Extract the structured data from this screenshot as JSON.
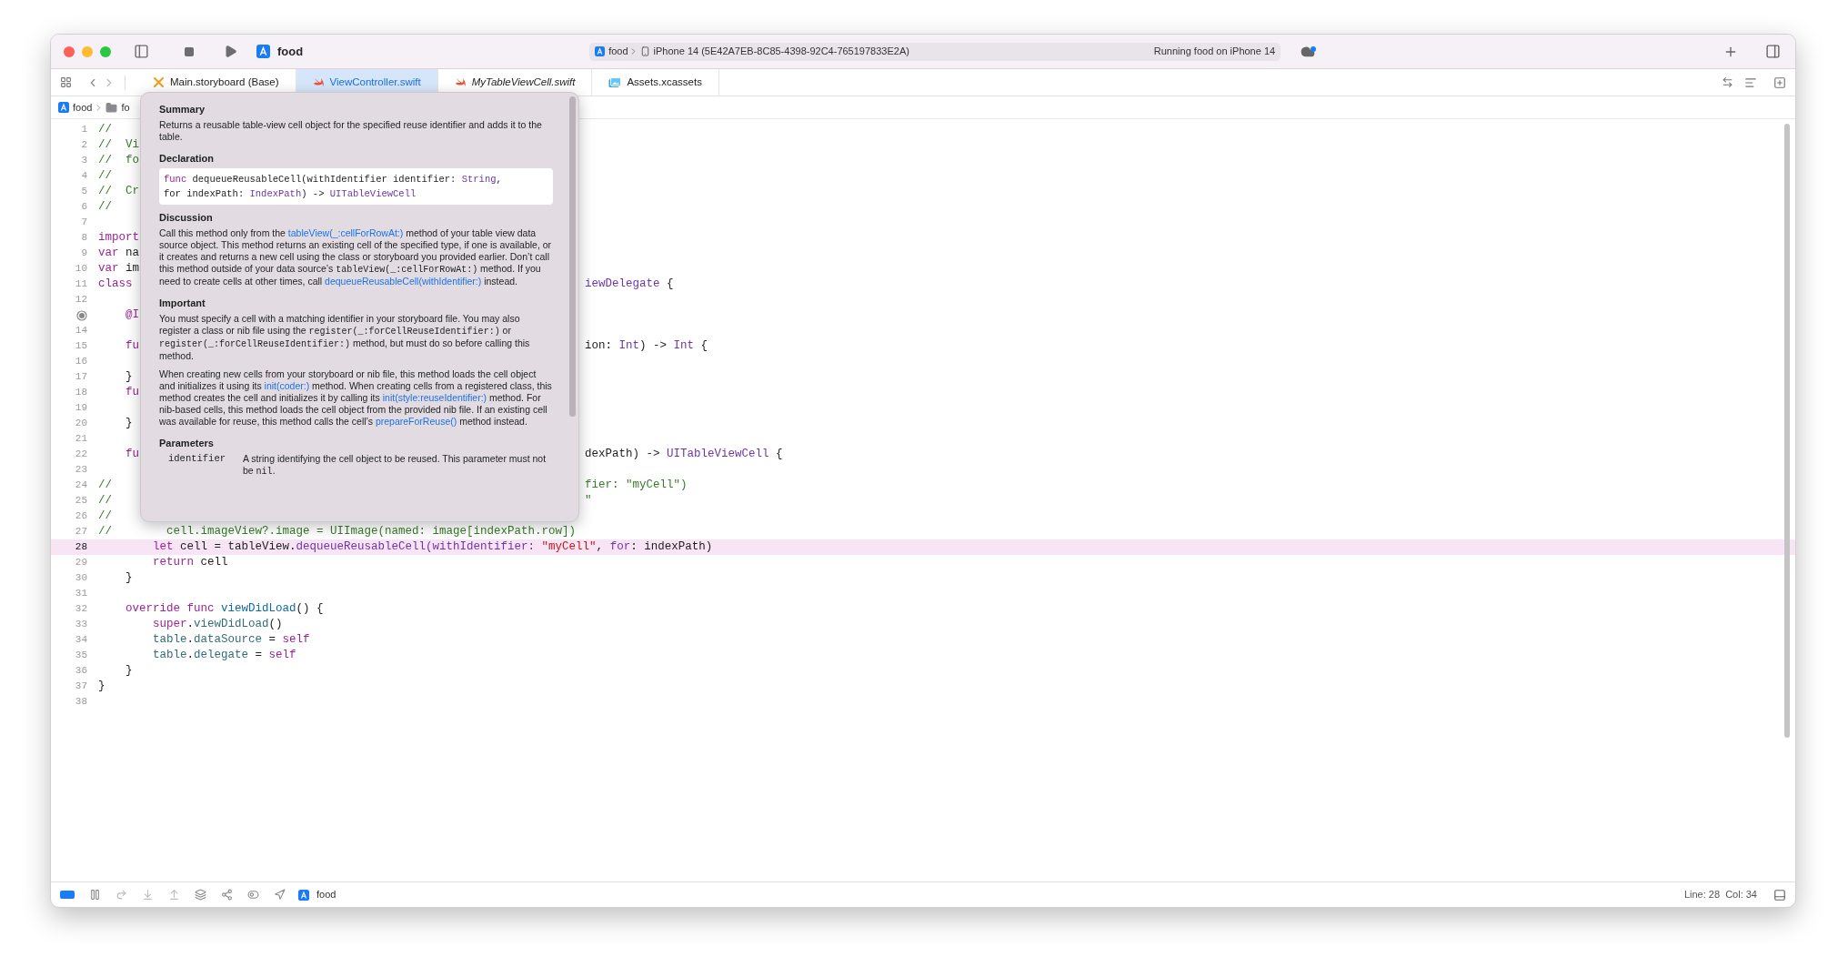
{
  "window": {
    "app_name": "food"
  },
  "toolbar": {
    "scheme": "food",
    "device": "iPhone 14 (5E42A7EB-8C85-4398-92C4-765197833E2A)",
    "status": "Running food on iPhone 14"
  },
  "tabs": [
    {
      "label": "Main.storyboard (Base)",
      "kind": "storyboard",
      "selected": false,
      "italic": false
    },
    {
      "label": "ViewController.swift",
      "kind": "swift",
      "selected": true,
      "italic": false
    },
    {
      "label": "MyTableViewCell.swift",
      "kind": "swift",
      "selected": false,
      "italic": true
    },
    {
      "label": "Assets.xcassets",
      "kind": "assets",
      "selected": false,
      "italic": false
    }
  ],
  "breadcrumb": [
    {
      "label": "food",
      "kind": "project"
    },
    {
      "label": "fo",
      "kind": "folder"
    }
  ],
  "editor": {
    "lines": [
      {
        "number": "1",
        "highlighted": false,
        "outlet_connected": false,
        "left": [
          {
            "text": "//",
            "kind": "comment"
          }
        ]
      },
      {
        "number": "2",
        "highlighted": false,
        "outlet_connected": false,
        "left": [
          {
            "text": "//  Vi",
            "kind": "comment"
          }
        ]
      },
      {
        "number": "3",
        "highlighted": false,
        "outlet_connected": false,
        "left": [
          {
            "text": "//  fo",
            "kind": "comment"
          }
        ]
      },
      {
        "number": "4",
        "highlighted": false,
        "outlet_connected": false,
        "left": [
          {
            "text": "//",
            "kind": "comment"
          }
        ]
      },
      {
        "number": "5",
        "highlighted": false,
        "outlet_connected": false,
        "left": [
          {
            "text": "//  Cr",
            "kind": "comment"
          }
        ]
      },
      {
        "number": "6",
        "highlighted": false,
        "outlet_connected": false,
        "left": [
          {
            "text": "//",
            "kind": "comment"
          }
        ]
      },
      {
        "number": "7",
        "highlighted": false,
        "outlet_connected": false
      },
      {
        "number": "8",
        "highlighted": false,
        "outlet_connected": false,
        "left": [
          {
            "text": "import",
            "kind": "kw"
          }
        ]
      },
      {
        "number": "9",
        "highlighted": false,
        "outlet_connected": false,
        "left": [
          {
            "text": "var",
            "kind": "kw"
          },
          {
            "text": " na",
            "kind": "plain"
          }
        ]
      },
      {
        "number": "10",
        "highlighted": false,
        "outlet_connected": false,
        "left": [
          {
            "text": "var",
            "kind": "kw"
          },
          {
            "text": " im",
            "kind": "plain"
          }
        ]
      },
      {
        "number": "11",
        "highlighted": false,
        "outlet_connected": false,
        "left": [
          {
            "text": "class",
            "kind": "kw"
          }
        ],
        "right": [
          {
            "text": "iewDelegate",
            "kind": "type"
          },
          {
            "text": " {",
            "kind": "plain"
          }
        ]
      },
      {
        "number": "12",
        "highlighted": false,
        "outlet_connected": false
      },
      {
        "highlighted": false,
        "outlet_connected": true,
        "left": [
          {
            "text": "    @I",
            "kind": "kw"
          }
        ]
      },
      {
        "number": "14",
        "highlighted": false,
        "outlet_connected": false
      },
      {
        "number": "15",
        "highlighted": false,
        "outlet_connected": false,
        "left": [
          {
            "text": "    fu",
            "kind": "kw"
          }
        ],
        "right": [
          {
            "text": "ion: ",
            "kind": "plain"
          },
          {
            "text": "Int",
            "kind": "type"
          },
          {
            "text": ") -> ",
            "kind": "plain"
          },
          {
            "text": "Int",
            "kind": "type"
          },
          {
            "text": " {",
            "kind": "plain"
          }
        ]
      },
      {
        "number": "16",
        "highlighted": false,
        "outlet_connected": false
      },
      {
        "number": "17",
        "highlighted": false,
        "outlet_connected": false,
        "left": [
          {
            "text": "    }",
            "kind": "plain"
          }
        ]
      },
      {
        "number": "18",
        "highlighted": false,
        "outlet_connected": false,
        "left": [
          {
            "text": "    fu",
            "kind": "kw"
          }
        ]
      },
      {
        "number": "19",
        "highlighted": false,
        "outlet_connected": false
      },
      {
        "number": "20",
        "highlighted": false,
        "outlet_connected": false,
        "left": [
          {
            "text": "    }",
            "kind": "plain"
          }
        ]
      },
      {
        "number": "21",
        "highlighted": false,
        "outlet_connected": false
      },
      {
        "number": "22",
        "highlighted": false,
        "outlet_connected": false,
        "left": [
          {
            "text": "    fu",
            "kind": "kw"
          }
        ],
        "right": [
          {
            "text": "dexPath) -> ",
            "kind": "plain"
          },
          {
            "text": "UITableViewCell",
            "kind": "type"
          },
          {
            "text": " {",
            "kind": "plain"
          }
        ]
      },
      {
        "number": "23",
        "highlighted": false,
        "outlet_connected": false
      },
      {
        "number": "24",
        "highlighted": false,
        "outlet_connected": false,
        "left": [
          {
            "text": "//",
            "kind": "comment"
          }
        ],
        "right": [
          {
            "text": "fier: \"myCell\")",
            "kind": "comment"
          }
        ]
      },
      {
        "number": "25",
        "highlighted": false,
        "outlet_connected": false,
        "left": [
          {
            "text": "//",
            "kind": "comment"
          }
        ],
        "right": [
          {
            "text": "\"",
            "kind": "comment"
          }
        ]
      },
      {
        "number": "26",
        "highlighted": false,
        "outlet_connected": false,
        "left": [
          {
            "text": "//",
            "kind": "comment"
          }
        ]
      },
      {
        "number": "27",
        "highlighted": false,
        "outlet_connected": false,
        "left": [
          {
            "text": "//        cell.imageView?.image = UIImage(named: image[indexPath.row])",
            "kind": "comment"
          }
        ]
      },
      {
        "number": "28",
        "highlighted": true,
        "outlet_connected": false,
        "left": [
          {
            "text": "        let",
            "kind": "kw"
          },
          {
            "text": " cell = tableView.",
            "kind": "plain"
          },
          {
            "text": "dequeueReusableCell(withIdentifier:",
            "kind": "call"
          },
          {
            "text": " \"myCell\"",
            "kind": "str"
          },
          {
            "text": ", ",
            "kind": "plain"
          },
          {
            "text": "for",
            "kind": "call"
          },
          {
            "text": ": indexPath)",
            "kind": "plain"
          }
        ]
      },
      {
        "number": "29",
        "highlighted": false,
        "outlet_connected": false,
        "left": [
          {
            "text": "        return",
            "kind": "kw"
          },
          {
            "text": " cell",
            "kind": "plain"
          }
        ]
      },
      {
        "number": "30",
        "highlighted": false,
        "outlet_connected": false,
        "left": [
          {
            "text": "    }",
            "kind": "plain"
          }
        ]
      },
      {
        "number": "31",
        "highlighted": false,
        "outlet_connected": false
      },
      {
        "number": "32",
        "highlighted": false,
        "outlet_connected": false,
        "left": [
          {
            "text": "    override func",
            "kind": "kw"
          },
          {
            "text": " viewDidLoad",
            "kind": "decl"
          },
          {
            "text": "() {",
            "kind": "plain"
          }
        ]
      },
      {
        "number": "33",
        "highlighted": false,
        "outlet_connected": false,
        "left": [
          {
            "text": "        super",
            "kind": "kw"
          },
          {
            "text": ".",
            "kind": "plain"
          },
          {
            "text": "viewDidLoad",
            "kind": "member"
          },
          {
            "text": "()",
            "kind": "plain"
          }
        ]
      },
      {
        "number": "34",
        "highlighted": false,
        "outlet_connected": false,
        "left": [
          {
            "text": "        table",
            "kind": "member"
          },
          {
            "text": ".",
            "kind": "plain"
          },
          {
            "text": "dataSource",
            "kind": "member"
          },
          {
            "text": " = ",
            "kind": "plain"
          },
          {
            "text": "self",
            "kind": "kw"
          }
        ]
      },
      {
        "number": "35",
        "highlighted": false,
        "outlet_connected": false,
        "left": [
          {
            "text": "        table",
            "kind": "member"
          },
          {
            "text": ".",
            "kind": "plain"
          },
          {
            "text": "delegate",
            "kind": "member"
          },
          {
            "text": " = ",
            "kind": "plain"
          },
          {
            "text": "self",
            "kind": "kw"
          }
        ]
      },
      {
        "number": "36",
        "highlighted": false,
        "outlet_connected": false,
        "left": [
          {
            "text": "    }",
            "kind": "plain"
          }
        ]
      },
      {
        "number": "37",
        "highlighted": false,
        "outlet_connected": false,
        "left": [
          {
            "text": "}",
            "kind": "plain"
          }
        ]
      },
      {
        "number": "38",
        "highlighted": false,
        "outlet_connected": false
      }
    ]
  },
  "quick_help": {
    "sections": [
      {
        "heading": "Summary",
        "kind": "text",
        "paragraphs": [
          [
            {
              "text": "Returns a reusable table-view cell object for the specified reuse identifier and adds it to the table.",
              "kind": "text"
            }
          ]
        ]
      },
      {
        "heading": "Declaration",
        "kind": "code",
        "lines": [
          [
            {
              "text": "func",
              "kind": "kw"
            },
            {
              "text": " dequeueReusableCell(withIdentifier identifier: ",
              "kind": "plain"
            },
            {
              "text": "String",
              "kind": "type"
            },
            {
              "text": ",",
              "kind": "plain"
            }
          ],
          [
            {
              "text": "for indexPath: ",
              "kind": "plain"
            },
            {
              "text": "IndexPath",
              "kind": "type"
            },
            {
              "text": ") -> ",
              "kind": "plain"
            },
            {
              "text": "UITableViewCell",
              "kind": "type"
            }
          ]
        ]
      },
      {
        "heading": "Discussion",
        "kind": "text",
        "paragraphs": [
          [
            {
              "text": "Call this method only from the ",
              "kind": "text"
            },
            {
              "text": "tableView(_:cellForRowAt:)",
              "kind": "link"
            },
            {
              "text": " method of your table view data source object. This method returns an existing cell of the specified type, if one is available, or it creates and returns a new cell using the class or storyboard you provided earlier. Don’t call this method outside of your data source’s ",
              "kind": "text"
            },
            {
              "text": "tableView(_:cellForRowAt:)",
              "kind": "code"
            },
            {
              "text": " method. If you need to create cells at other times, call ",
              "kind": "text"
            },
            {
              "text": "dequeueReusableCell(withIdentifier:)",
              "kind": "link"
            },
            {
              "text": " instead.",
              "kind": "text"
            }
          ]
        ]
      },
      {
        "heading": "Important",
        "kind": "text",
        "paragraphs": [
          [
            {
              "text": "You must specify a cell with a matching identifier in your storyboard file. You may also register a class or nib file using the ",
              "kind": "text"
            },
            {
              "text": "register(_:forCellReuseIdentifier:)",
              "kind": "code"
            },
            {
              "text": " or ",
              "kind": "text"
            },
            {
              "text": "register(_:forCellReuseIdentifier:)",
              "kind": "code"
            },
            {
              "text": " method, but must do so before calling this method.",
              "kind": "text"
            }
          ],
          [
            {
              "text": "When creating new cells from your storyboard or nib file, this method loads the cell object and initializes it using its ",
              "kind": "text"
            },
            {
              "text": "init(coder:)",
              "kind": "link"
            },
            {
              "text": " method. When creating cells from a registered class, this method creates the cell and initializes it by calling its ",
              "kind": "text"
            },
            {
              "text": "init(style:reuseIdentifier:)",
              "kind": "link"
            },
            {
              "text": " method. For nib-based cells, this method loads the cell object from the provided nib file. If an existing cell was available for reuse, this method calls the cell’s ",
              "kind": "text"
            },
            {
              "text": "prepareForReuse()",
              "kind": "link"
            },
            {
              "text": " method instead.",
              "kind": "text"
            }
          ]
        ]
      },
      {
        "heading": "Parameters",
        "kind": "params",
        "params": [
          {
            "name": "identifier",
            "description": [
              {
                "text": "A string identifying the cell object to be reused. This parameter must not be ",
                "kind": "text"
              },
              {
                "text": "nil",
                "kind": "code"
              },
              {
                "text": ".",
                "kind": "text"
              }
            ]
          }
        ]
      }
    ]
  },
  "status_bar": {
    "breakpoints_active": true,
    "scheme": "food",
    "position": "Line: 28  Col: 34"
  }
}
